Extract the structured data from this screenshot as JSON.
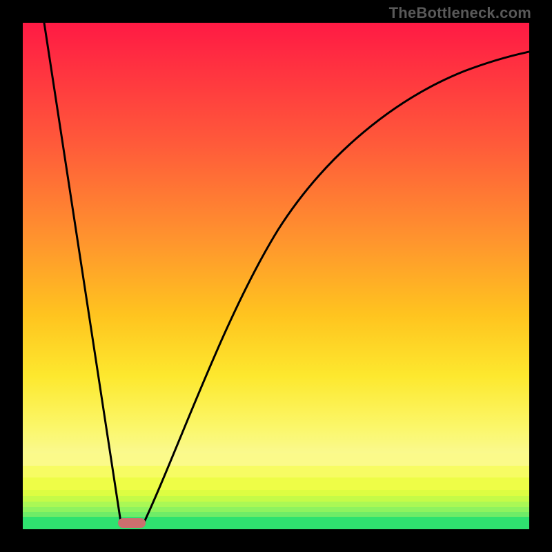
{
  "attribution": "TheBottleneck.com",
  "chart_data": {
    "type": "line",
    "title": "",
    "xlabel": "",
    "ylabel": "",
    "xlim": [
      0,
      100
    ],
    "ylim": [
      0,
      100
    ],
    "series": [
      {
        "name": "left-line",
        "x": [
          4.2,
          19.5
        ],
        "y": [
          100,
          0.5
        ]
      },
      {
        "name": "right-curve",
        "x": [
          23.5,
          26,
          29,
          32,
          36,
          40,
          45,
          50,
          55,
          60,
          66,
          73,
          80,
          88,
          96,
          100
        ],
        "y": [
          0.5,
          8,
          17,
          25,
          35,
          43,
          52,
          59,
          65,
          70,
          75,
          80,
          84,
          88,
          91.5,
          93
        ]
      }
    ],
    "marker": {
      "x_center": 21.5,
      "width": 5.3,
      "y_center": 0.9,
      "height": 1.8
    },
    "gradient_bands": [
      {
        "from_y": 15,
        "to_y": 100,
        "colors": [
          "#ff1a44",
          "#faf98e"
        ]
      },
      {
        "from_y": 12.6,
        "to_y": 15,
        "color": "#fbfa8a"
      },
      {
        "from_y": 10.2,
        "to_y": 12.6,
        "color": "#f7fc63"
      },
      {
        "from_y": 7.8,
        "to_y": 10.2,
        "color": "#eefd47"
      },
      {
        "from_y": 6.5,
        "to_y": 7.8,
        "color": "#ddfd42"
      },
      {
        "from_y": 5.4,
        "to_y": 6.5,
        "color": "#c5fb48"
      },
      {
        "from_y": 4.4,
        "to_y": 5.4,
        "color": "#aaf855"
      },
      {
        "from_y": 3.4,
        "to_y": 4.4,
        "color": "#8ef35f"
      },
      {
        "from_y": 2.4,
        "to_y": 3.4,
        "color": "#6fec67"
      },
      {
        "from_y": 0,
        "to_y": 2.4,
        "color": "#2fe26f"
      }
    ]
  }
}
